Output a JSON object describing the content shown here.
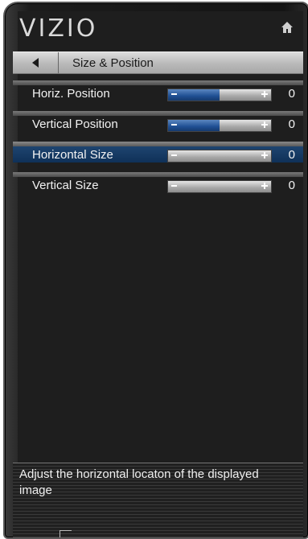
{
  "brand": "VIZIO",
  "icons": {
    "home": "home-icon",
    "back": "left-arrow-icon"
  },
  "menu": {
    "title": "Size & Position",
    "items": [
      {
        "label": "Horiz. Position",
        "value": "0",
        "level": 0.5,
        "selected": false
      },
      {
        "label": "Vertical Position",
        "value": "0",
        "level": 0.5,
        "selected": false
      },
      {
        "label": "Horizontal Size",
        "value": "0",
        "level": 0.0,
        "selected": true
      },
      {
        "label": "Vertical Size",
        "value": "0",
        "level": 0.0,
        "selected": false
      }
    ]
  },
  "help": {
    "text": "Adjust the horizontal locaton of  the displayed image"
  },
  "colors": {
    "accent": "#1f4f93",
    "selected_row": "#0f3158",
    "background": "#1e1e1e"
  }
}
